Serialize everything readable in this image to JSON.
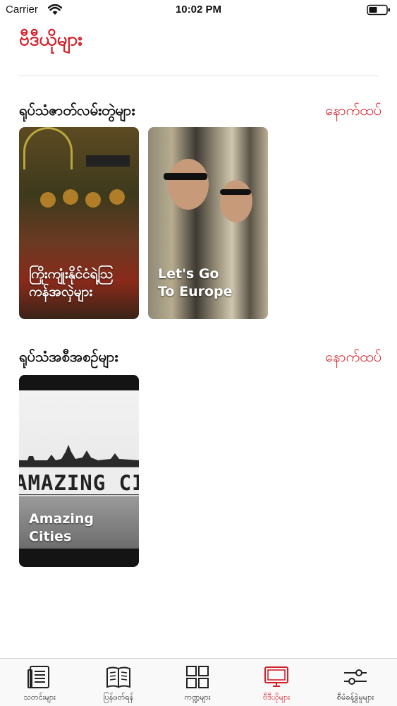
{
  "status_bar": {
    "carrier": "Carrier",
    "time": "10:02 PM"
  },
  "page": {
    "title": "ဗီဒီယိုများ"
  },
  "sections": [
    {
      "title": "ရုပ်သံဇာတ်လမ်းတွဲများ",
      "more": "နောက်ထပ်",
      "cards": [
        {
          "label": "ကြိုးကျုံးနိုင်ငံရဲ့သြ\nကန်အလှဲများ"
        },
        {
          "label": "Let's Go\nTo Europe"
        }
      ]
    },
    {
      "title": "ရုပ်သံအစီအစဉ်များ",
      "more": "နောက်ထပ်",
      "cards": [
        {
          "label": "Amazing\nCities",
          "banner_text": "AMAZING CITIE"
        }
      ]
    }
  ],
  "tab_bar": {
    "tabs": [
      {
        "label": "သတင်းများ",
        "icon": "news-icon",
        "active": false
      },
      {
        "label": "ပြန်ဖတ်ရန်",
        "icon": "book-icon",
        "active": false
      },
      {
        "label": "ကဏ္ဍများ",
        "icon": "grid-icon",
        "active": false
      },
      {
        "label": "ဗီဒီယိုများ",
        "icon": "monitor-icon",
        "active": true
      },
      {
        "label": "စီမံခန့်ခွဲမှုများ",
        "icon": "settings-sliders-icon",
        "active": false
      }
    ]
  },
  "colors": {
    "accent": "#d4202a",
    "tab_inactive": "#222222",
    "divider": "#e1e1e1"
  }
}
